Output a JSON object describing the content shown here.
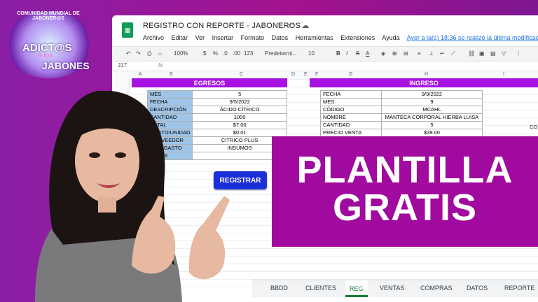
{
  "window": {
    "doc_title": "REGISTRO CON REPORTE - JABONEROS",
    "menu": [
      "Archivo",
      "Editar",
      "Ver",
      "Insertar",
      "Formato",
      "Datos",
      "Herramientas",
      "Extensiones",
      "Ayuda"
    ],
    "last_edit": "Ayer a la(s) 18:36 se realizó la última modificación."
  },
  "toolbar": {
    "zoom": "100%",
    "currency": "$",
    "percent": "%",
    "dec1": ".0",
    "dec2": ".00",
    "format123": "123",
    "font": "Predetermi...",
    "size": "10",
    "bold": "B",
    "italic": "I",
    "strike": "S",
    "textcolor": "A"
  },
  "formula": {
    "cell_ref": "J17",
    "fx": "fx"
  },
  "columns": [
    "A",
    "B",
    "C",
    "D",
    "E",
    "F",
    "G",
    "H",
    "I"
  ],
  "egresos": {
    "title": "EGRESOS",
    "rows": [
      {
        "label": "MES",
        "value": "5"
      },
      {
        "label": "FECHA",
        "value": "9/5/2022"
      },
      {
        "label": "DESCRIPCIÓN",
        "value": "ÁCIDO CÍTRICO"
      },
      {
        "label": "CANTIDAD",
        "value": "1000"
      },
      {
        "label": "TOTAL",
        "value": "$7.00"
      },
      {
        "label": "COSTO/UNIDAD",
        "value": "$0.01"
      },
      {
        "label": "PROVEEDOR",
        "value": "CITRICO PLUS"
      },
      {
        "label": "TIPO GASTO",
        "value": "INSUMOS"
      },
      {
        "label": "NOTAS",
        "value": ""
      }
    ]
  },
  "ingreso": {
    "title": "INGRESO",
    "rows": [
      {
        "label": "FECHA",
        "value": "9/9/2022"
      },
      {
        "label": "MES",
        "value": "9"
      },
      {
        "label": "CÓDIGO",
        "value": "MCAHL"
      },
      {
        "label": "NOMBRE",
        "value": "MANTECA CORPORAL HIERBA LUISA"
      },
      {
        "label": "CANTIDAD",
        "value": "5"
      },
      {
        "label": "PRECIO VENTA",
        "value": "$39.00"
      }
    ],
    "extra": "CO"
  },
  "register_button": "REGISTRAR",
  "promo": {
    "line1": "PLANTILLA",
    "line2": "GRATIS"
  },
  "tabs": [
    "BBDD",
    "CLIENTES",
    "REG",
    "VENTAS",
    "COMPRAS",
    "DATOS",
    "REPORTE"
  ],
  "active_tab": "REG",
  "logo": {
    "ring_text": "COMUNIDAD MUNDIAL DE JABONER@S",
    "line1": "ADICT@S",
    "line2": "a los",
    "line3": "JABONES"
  },
  "colors": {
    "accent": "#a712e0",
    "promo": "#a10a9e",
    "button": "#1a2fd8",
    "label_bg": "#9fc5e8",
    "sheets_green": "#0f9d58"
  }
}
